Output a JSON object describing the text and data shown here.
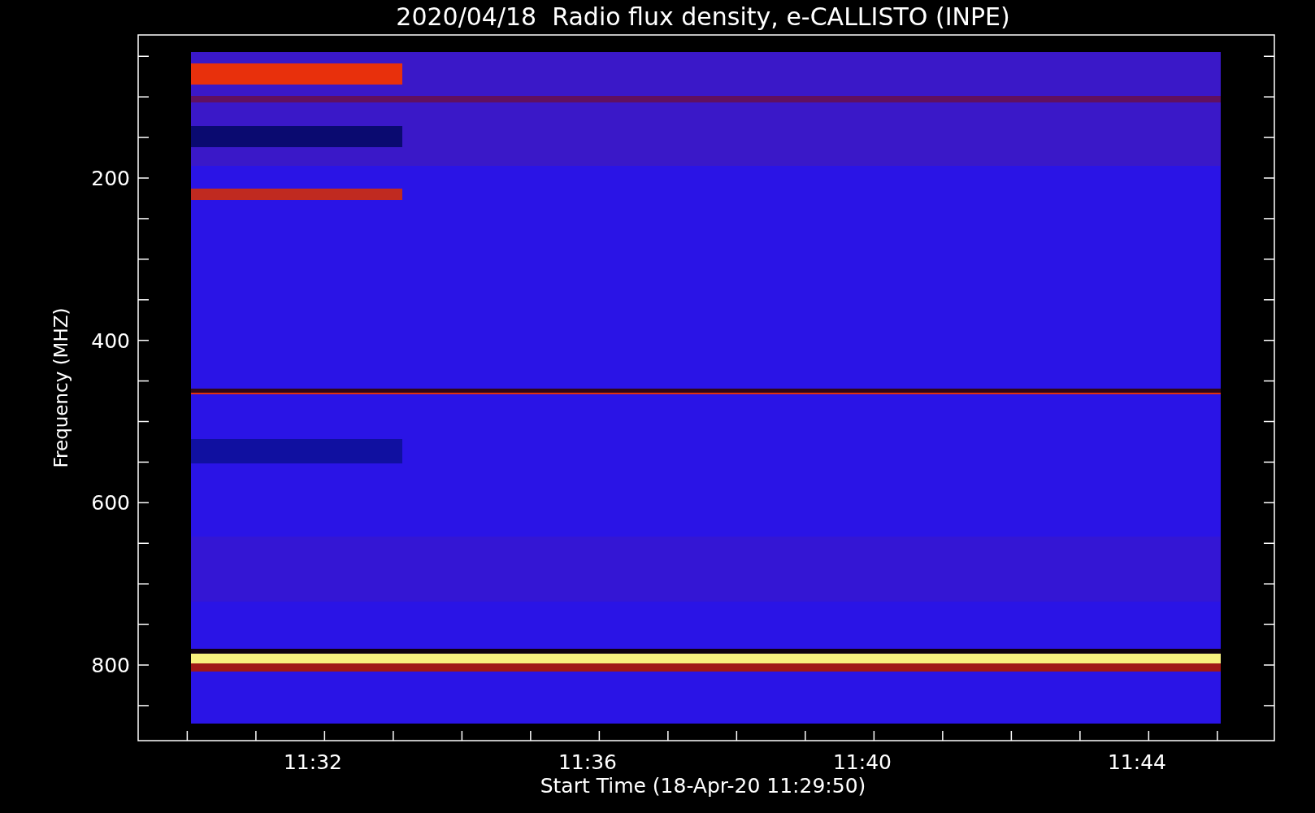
{
  "title": "2020/04/18  Radio flux density, e-CALLISTO (INPE)",
  "y_axis": {
    "label": "Frequency (MHZ)",
    "ticks": [
      "200",
      "400",
      "600",
      "800"
    ]
  },
  "x_axis": {
    "label": "Start Time (18-Apr-20 11:29:50)",
    "ticks": [
      "11:32",
      "11:36",
      "11:40",
      "11:44"
    ]
  }
}
